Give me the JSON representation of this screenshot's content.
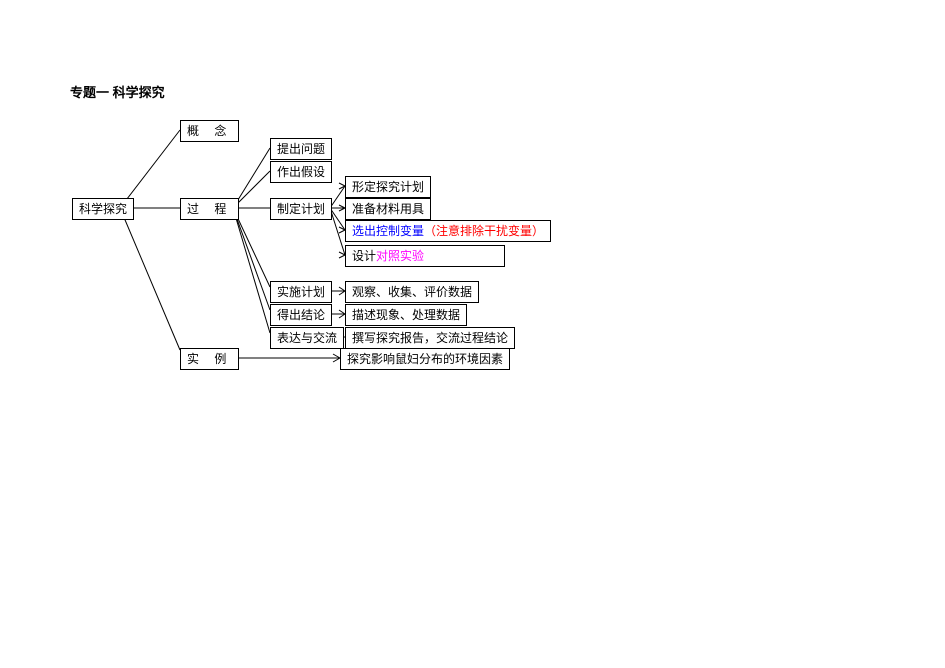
{
  "title": "专题一  科学探究",
  "root": "科学探究",
  "branches": {
    "concept": "概  念",
    "process": "过  程",
    "example": "实  例"
  },
  "process_children": {
    "q": "提出问题",
    "hypo": "作出假设",
    "plan": "制定计划",
    "impl": "实施计划",
    "concl": "得出结论",
    "express": "表达与交流"
  },
  "plan_children": {
    "sub1": "形定探究计划",
    "sub2": "准备材料用具",
    "sub3_main": "选出控制变量",
    "sub3_note": "（注意排除干扰变量）",
    "sub4_pre": "设计",
    "sub4_hl": "对照实验"
  },
  "impl_detail": "观察、收集、评价数据",
  "concl_detail": "描述现象、处理数据",
  "express_detail": "撰写探究报告，交流过程结论",
  "example_detail": "探究影响鼠妇分布的环境因素"
}
